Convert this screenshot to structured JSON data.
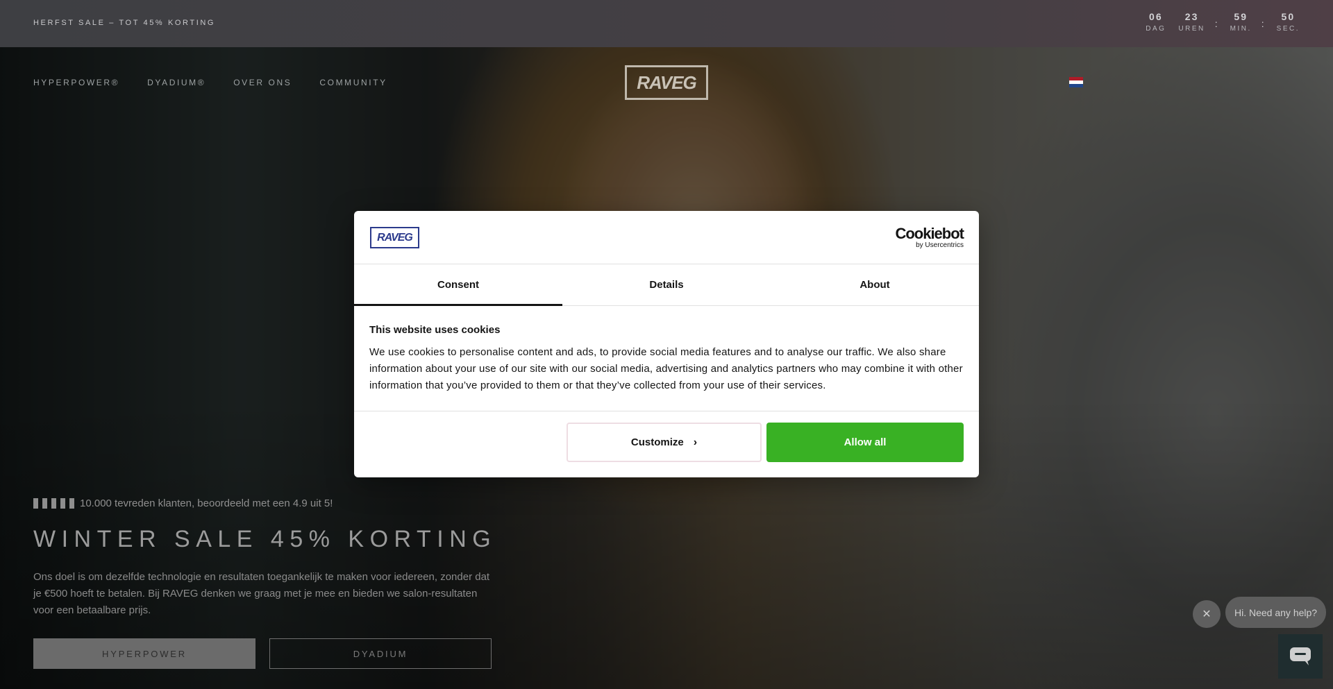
{
  "topbar": {
    "announcement": "HERFST SALE – TOT 45% KORTING",
    "countdown": [
      {
        "value": "06",
        "label": "DAG"
      },
      {
        "value": "23",
        "label": "UREN"
      },
      {
        "value": "59",
        "label": "MIN."
      },
      {
        "value": "50",
        "label": "SEC."
      }
    ],
    "separator": ":"
  },
  "nav": {
    "items": [
      "HYPERPOWER®",
      "DYADIUM®",
      "OVER ONS",
      "COMMUNITY"
    ],
    "logo": "RAVEG",
    "language_flag": "flag-nl-icon",
    "flag_colors": [
      "#ae1c28",
      "#ffffff",
      "#21468b"
    ]
  },
  "hero": {
    "rating_text": "10.000 tevreden klanten, beoordeeld met een 4.9 uit 5!",
    "title": "WINTER SALE 45% KORTING",
    "description": "Ons doel is om dezelfde technologie en resultaten toegankelijk te maken voor iedereen, zonder dat je €500 hoeft te betalen. Bij RAVEG denken we graag met je mee en bieden we salon-resultaten voor een betaalbare prijs.",
    "button_primary": "HYPERPOWER",
    "button_secondary": "DYADIUM"
  },
  "cookie_dialog": {
    "logo": "RAVEG",
    "provider_name": "Cookiebot",
    "provider_sub": "by Usercentrics",
    "tabs": [
      "Consent",
      "Details",
      "About"
    ],
    "active_tab": "Consent",
    "heading": "This website uses cookies",
    "body": "We use cookies to personalise content and ads, to provide social media features and to analyse our traffic. We also share information about your use of our site with our social media, advertising and analytics partners who may combine it with other information that you’ve provided to them or that they’ve collected from your use of their services.",
    "customize_label": "Customize",
    "allow_label": "Allow all",
    "allow_color": "#39b124"
  },
  "chat": {
    "bubble_text": "Hi. Need any help?",
    "close_icon": "close-icon",
    "launcher_icon": "chat-icon"
  }
}
